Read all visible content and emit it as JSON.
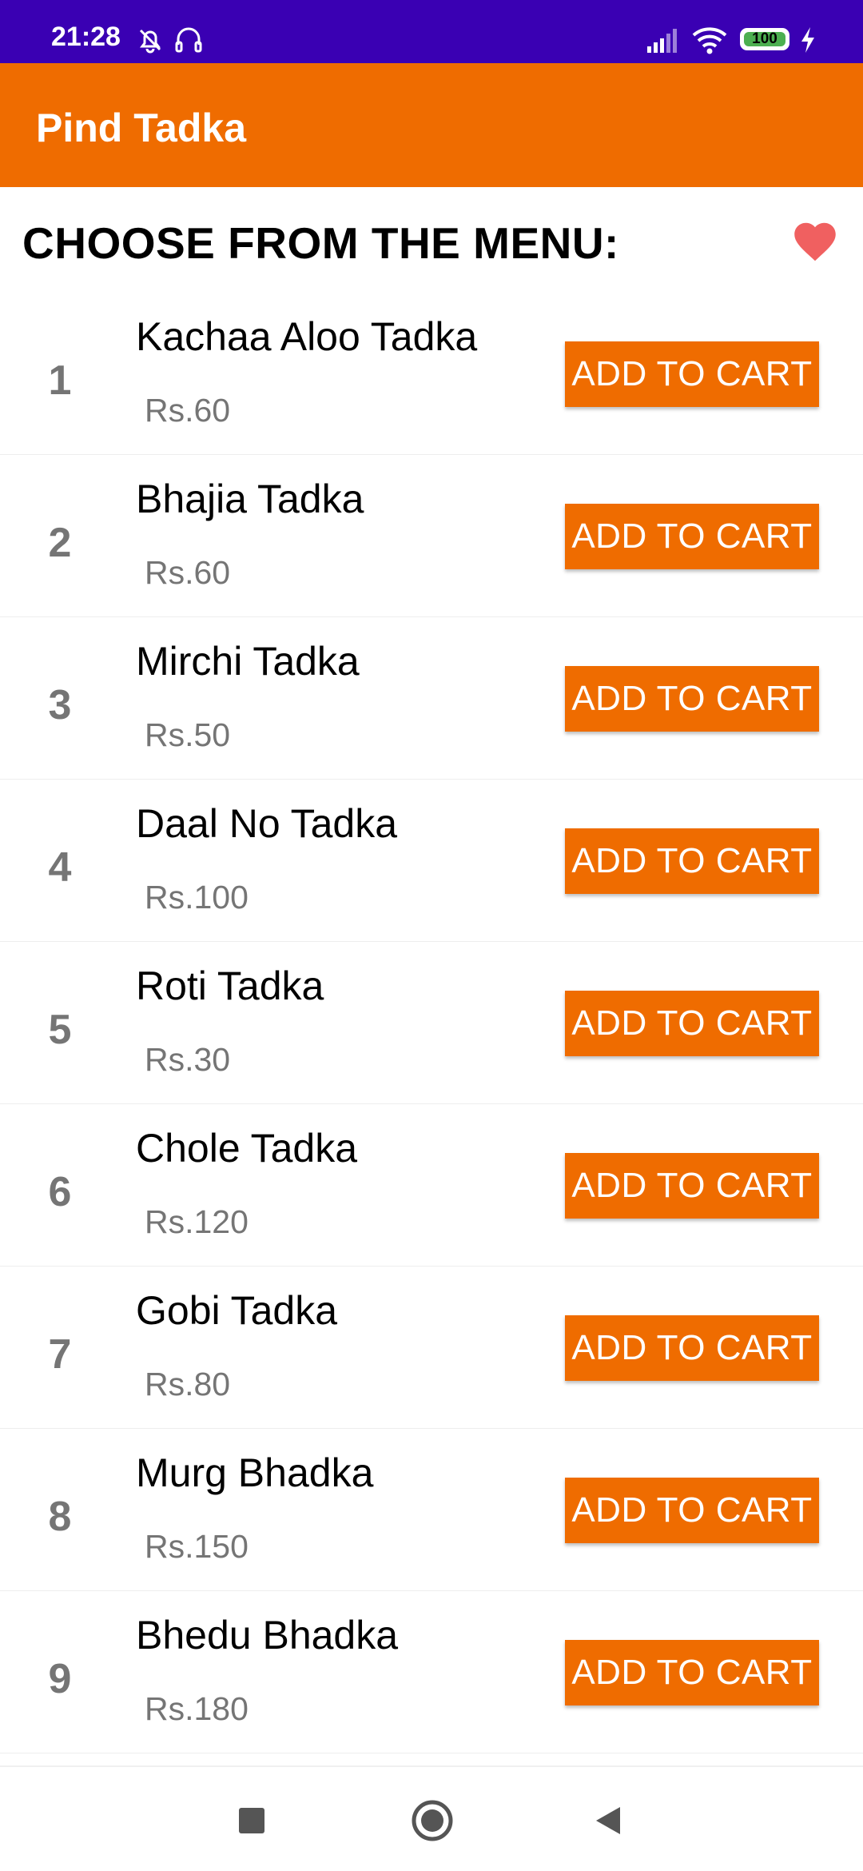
{
  "status_bar": {
    "time": "21:28",
    "battery": "100",
    "icons": [
      "bell-off-icon",
      "headset-icon",
      "signal-icon",
      "wifi-icon",
      "battery-icon",
      "charging-icon"
    ]
  },
  "app_bar": {
    "title": "Pind Tadka"
  },
  "menu": {
    "heading": "CHOOSE FROM THE MENU:",
    "favorite_icon": "heart-icon",
    "items": [
      {
        "number": "1",
        "name": "Kachaa Aloo Tadka",
        "price": "Rs.60",
        "button": "ADD TO CART"
      },
      {
        "number": "2",
        "name": "Bhajia Tadka",
        "price": "Rs.60",
        "button": "ADD TO CART"
      },
      {
        "number": "3",
        "name": "Mirchi Tadka",
        "price": "Rs.50",
        "button": "ADD TO CART"
      },
      {
        "number": "4",
        "name": "Daal No Tadka",
        "price": "Rs.100",
        "button": "ADD TO CART"
      },
      {
        "number": "5",
        "name": "Roti Tadka",
        "price": "Rs.30",
        "button": "ADD TO CART"
      },
      {
        "number": "6",
        "name": "Chole Tadka",
        "price": "Rs.120",
        "button": "ADD TO CART"
      },
      {
        "number": "7",
        "name": "Gobi Tadka",
        "price": "Rs.80",
        "button": "ADD TO CART"
      },
      {
        "number": "8",
        "name": "Murg Bhadka",
        "price": "Rs.150",
        "button": "ADD TO CART"
      },
      {
        "number": "9",
        "name": "Bhedu Bhadka",
        "price": "Rs.180",
        "button": "ADD TO CART"
      }
    ]
  },
  "nav_bar": {
    "icons": [
      "recents-square-icon",
      "home-circle-icon",
      "back-triangle-icon"
    ]
  },
  "colors": {
    "status_bar": "#3a00b3",
    "accent": "#ef6c00",
    "heart": "#f06060",
    "secondary_text": "#757575"
  }
}
